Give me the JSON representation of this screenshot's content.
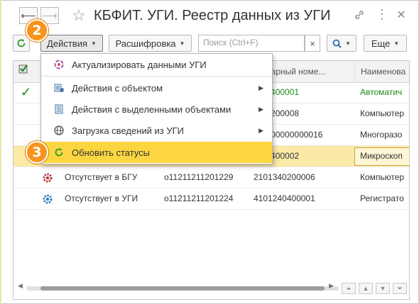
{
  "window": {
    "title": "КБФИТ. УГИ. Реестр данных из УГИ",
    "icons": [
      "link-icon",
      "more-icon",
      "close-icon"
    ]
  },
  "toolbar": {
    "refresh_icon": "refresh-icon",
    "actions_label": "Действия",
    "decode_label": "Расшифровка",
    "search_placeholder": "Поиск (Ctrl+F)",
    "search_clear": "×",
    "search_button_icon": "search-icon",
    "more_label": "Еще"
  },
  "table": {
    "columns": [
      "",
      "",
      "",
      "ентарный номе...",
      "Наименова"
    ],
    "rows": [
      {
        "mark": "✓",
        "status": "",
        "code": "",
        "inv": "200400001",
        "name": "Автоматич",
        "green": true,
        "selected": false
      },
      {
        "mark": "",
        "status": "",
        "code": "",
        "inv": "340200008",
        "name": "Компьютер",
        "green": false,
        "selected": false
      },
      {
        "mark": "",
        "status": "",
        "code": "",
        "inv": "00000000000016",
        "name": "Многоразо",
        "green": false,
        "selected": false
      },
      {
        "mark": "",
        "status": "",
        "code": "",
        "inv": "200400002",
        "name": "Микроскоп",
        "green": false,
        "selected": true
      },
      {
        "mark": "",
        "status": "Отсутствует в БГУ",
        "code": "о11211211201229",
        "inv": "2101340200006",
        "name": "Компьютер",
        "green": false,
        "selected": false,
        "icon_color": "#b23030"
      },
      {
        "mark": "",
        "status": "Отсутствует в УГИ",
        "code": "о11211211201224",
        "inv": "4101240400001",
        "name": "Регистрато",
        "green": false,
        "selected": false,
        "icon_color": "#2a78b8"
      }
    ]
  },
  "menu": {
    "items": [
      {
        "label": "Актуализировать данными УГИ",
        "icon": "sync-icon",
        "submenu": false,
        "highlight": false
      },
      {
        "label": "Действия с объектом",
        "icon": "object-icon",
        "submenu": true,
        "highlight": false
      },
      {
        "label": "Действия с выделенными объектами",
        "icon": "list-icon",
        "submenu": true,
        "highlight": false
      },
      {
        "label": "Загрузка сведений из УГИ",
        "icon": "globe-icon",
        "submenu": true,
        "highlight": false
      },
      {
        "label": "Обновить статусы",
        "icon": "refresh-icon",
        "submenu": false,
        "highlight": true
      }
    ]
  },
  "steps": {
    "step2": "2",
    "step3": "3"
  },
  "colors": {
    "accent": "#f7941d",
    "highlight": "#fbd640",
    "green": "#1a8a1a"
  }
}
